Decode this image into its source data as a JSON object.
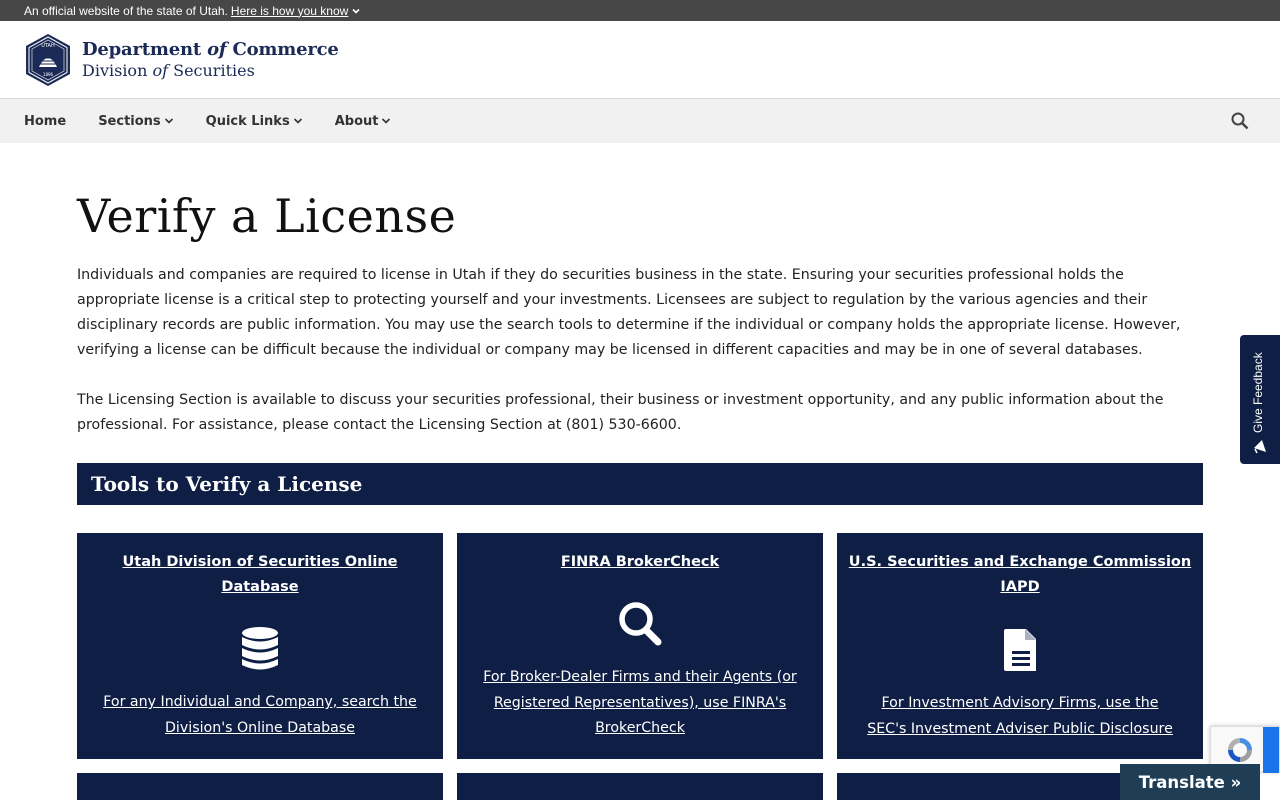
{
  "official_bar": {
    "text": "An official website of the state of Utah.",
    "link": "Here is how you know"
  },
  "logo": {
    "title_part1": "Department ",
    "title_of": "of",
    "title_part2": " Commerce",
    "sub_part1": "Division ",
    "sub_of": "of",
    "sub_part2": " Securities",
    "seal_text_top": "UTAH",
    "seal_text_bottom": "1896"
  },
  "nav": {
    "items": [
      "Home",
      "Sections",
      "Quick Links",
      "About"
    ]
  },
  "page": {
    "title": "Verify a License",
    "paragraphs": [
      "Individuals and companies are required to license in Utah if they do securities business in the state.  Ensuring your securities professional holds the appropriate license is a critical step to protecting yourself and your investments.   Licensees are subject to regulation by the various agencies and their disciplinary records are public information.  You may use the search tools to determine if the individual or company holds the appropriate license. However, verifying a license can be difficult because the individual or company may be licensed in different capacities and may be in one of several databases.",
      "The Licensing Section is available to discuss your securities professional, their business or investment opportunity, and any public information about the professional.  For assistance, please contact the Licensing Section at (801) 530-6600."
    ],
    "section_heading": "Tools to Verify a License"
  },
  "cards": [
    {
      "title": "Utah Division of Securities Online Database",
      "icon": "database-icon",
      "description": "For any Individual and Company, search the Division's Online Database"
    },
    {
      "title": "FINRA BrokerCheck",
      "icon": "search-icon",
      "description": "For Broker-Dealer Firms and their Agents (or Registered Representatives), use FINRA's BrokerCheck"
    },
    {
      "title": "U.S. Securities and Exchange Commission IAPD",
      "icon": "document-icon",
      "description": "For Investment Advisory Firms, use the SEC's Investment Adviser Public Disclosure"
    }
  ],
  "feedback": {
    "label": "Give Feedback"
  },
  "translate": {
    "label": "Translate »"
  },
  "colors": {
    "navy": "#0f1e45",
    "official_bar": "#474747",
    "nav_bg": "#f1f1f1",
    "translate_bg": "#1f3e56"
  }
}
